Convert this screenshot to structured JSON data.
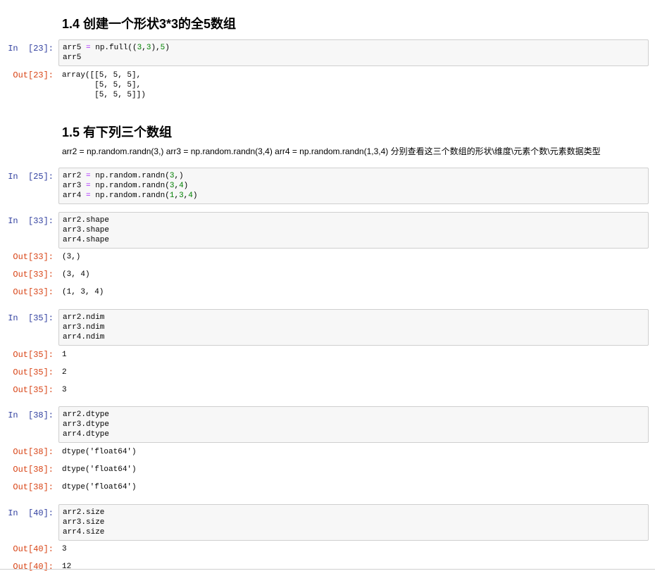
{
  "sections": {
    "h14": "1.4  创建一个形状3*3的全5数组",
    "h15": "1.5  有下列三个数组",
    "desc15": "arr2 = np.random.randn(3,) arr3 = np.random.randn(3,4) arr4 = np.random.randn(1,3,4) 分别查看这三个数组的形状\\维度\\元素个数\\元素数据类型"
  },
  "cells": {
    "c23": {
      "in_prompt": "In  [23]:",
      "out_prompt": "Out[23]:",
      "code": {
        "l1a": "arr5",
        "l1op": " = ",
        "l1b": "np.full((",
        "l1n1": "3",
        "l1c": ",",
        "l1n2": "3",
        "l1d": "),",
        "l1n3": "5",
        "l1e": ")",
        "l2": "arr5"
      },
      "output": [
        "array([[5, 5, 5],",
        "       [5, 5, 5],",
        "       [5, 5, 5]])"
      ]
    },
    "c25": {
      "in_prompt": "In  [25]:",
      "code": {
        "l1a": "arr2",
        "l1op": " = ",
        "l1b": "np.random.randn(",
        "l1n1": "3",
        "l1e": ",)",
        "l2a": "arr3",
        "l2op": " = ",
        "l2b": "np.random.randn(",
        "l2n1": "3",
        "l2c": ",",
        "l2n2": "4",
        "l2e": ")",
        "l3a": "arr4",
        "l3op": " = ",
        "l3b": "np.random.randn(",
        "l3n1": "1",
        "l3c": ",",
        "l3n2": "3",
        "l3d": ",",
        "l3n3": "4",
        "l3e": ")"
      }
    },
    "c33": {
      "in_prompt": "In  [33]:",
      "code": [
        "arr2.shape",
        "arr3.shape",
        "arr4.shape"
      ],
      "out_prompts": [
        "Out[33]:",
        "Out[33]:",
        "Out[33]:"
      ],
      "outputs": [
        "(3,)",
        "(3, 4)",
        "(1, 3, 4)"
      ]
    },
    "c35": {
      "in_prompt": "In  [35]:",
      "code": [
        "arr2.ndim",
        "arr3.ndim",
        "arr4.ndim"
      ],
      "out_prompts": [
        "Out[35]:",
        "Out[35]:",
        "Out[35]:"
      ],
      "outputs": [
        "1",
        "2",
        "3"
      ]
    },
    "c38": {
      "in_prompt": "In  [38]:",
      "code": [
        "arr2.dtype",
        "arr3.dtype",
        "arr4.dtype"
      ],
      "out_prompts": [
        "Out[38]:",
        "Out[38]:",
        "Out[38]:"
      ],
      "outputs": [
        "dtype('float64')",
        "dtype('float64')",
        "dtype('float64')"
      ]
    },
    "c40": {
      "in_prompt": "In  [40]:",
      "code": [
        "arr2.size",
        "arr3.size",
        "arr4.size"
      ],
      "out_prompts": [
        "Out[40]:",
        "Out[40]:"
      ],
      "outputs": [
        "3",
        "12"
      ]
    }
  }
}
